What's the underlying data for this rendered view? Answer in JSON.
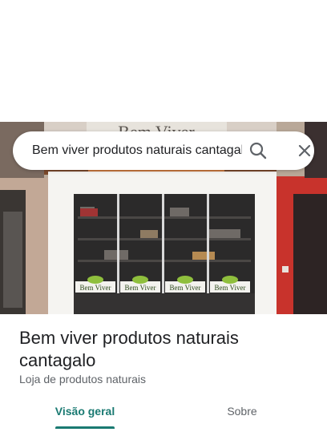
{
  "search": {
    "query": "Bem viver produtos naturais cantagalo",
    "search_icon": "search-icon",
    "close_icon": "close-icon"
  },
  "photo": {
    "sign_top": "Bem Viver",
    "decal_labels": [
      "Bem Viver",
      "Bem Viver",
      "Bem Viver",
      "Bem Viver"
    ]
  },
  "place": {
    "title": "Bem viver produtos naturais cantagalo",
    "category": "Loja de produtos naturais"
  },
  "tabs": [
    {
      "label": "Visão geral",
      "active": true
    },
    {
      "label": "Sobre",
      "active": false
    }
  ],
  "colors": {
    "accent": "#1a7a72",
    "text_primary": "#202124",
    "text_secondary": "#5f6368"
  }
}
